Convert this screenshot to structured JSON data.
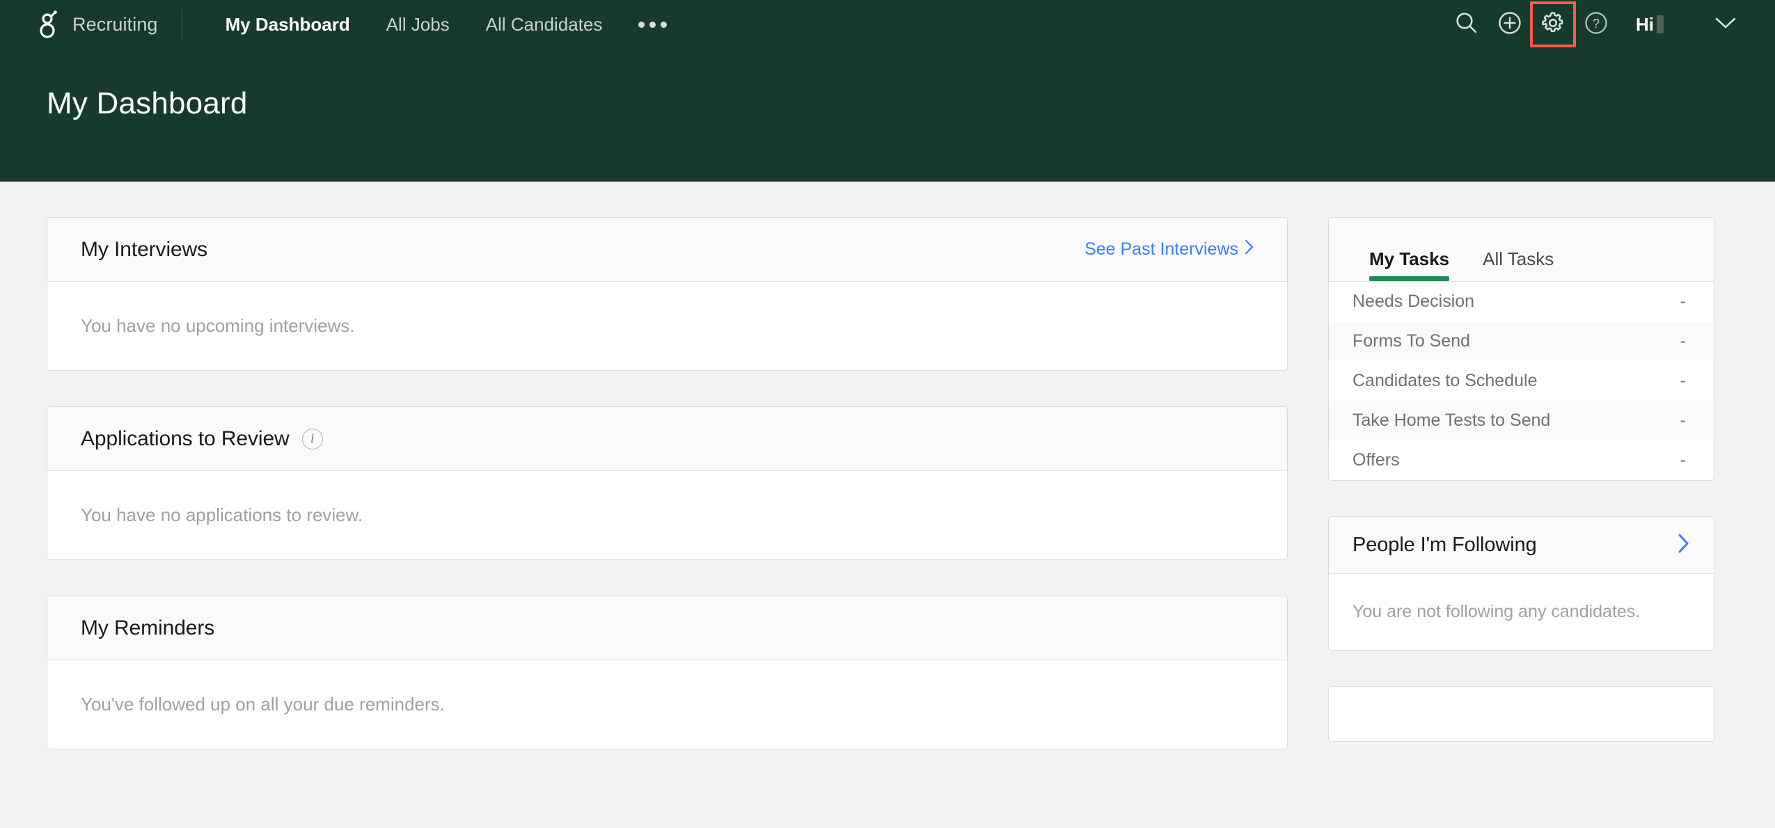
{
  "header": {
    "logo_icon": "greenhouse-g-logo",
    "brand": "Recruiting",
    "nav": [
      {
        "label": "My Dashboard",
        "active": true
      },
      {
        "label": "All Jobs",
        "active": false
      },
      {
        "label": "All Candidates",
        "active": false
      }
    ],
    "more_menu_icon": "ellipsis-icon",
    "actions": [
      {
        "name": "search-icon",
        "highlighted": false
      },
      {
        "name": "add-icon",
        "highlighted": false
      },
      {
        "name": "gear-icon",
        "highlighted": true
      },
      {
        "name": "help-icon",
        "highlighted": false
      }
    ],
    "greeting": "Hi",
    "account_chevron_icon": "chevron-down-icon",
    "page_title": "My Dashboard",
    "highlight_color": "#fb5a47",
    "background_color": "#183a2c"
  },
  "main": {
    "cards": [
      {
        "title": "My Interviews",
        "link_label": "See Past Interviews",
        "link_chevron": "›",
        "has_info_icon": false,
        "empty_text": "You have no upcoming interviews."
      },
      {
        "title": "Applications to Review",
        "link_label": "",
        "has_info_icon": true,
        "info_glyph": "i",
        "empty_text": "You have no applications to review."
      },
      {
        "title": "My Reminders",
        "link_label": "",
        "has_info_icon": false,
        "empty_text": "You've followed up on all your due reminders."
      }
    ],
    "link_color": "#3d7ff0"
  },
  "sidebar": {
    "tasks": {
      "tabs": [
        {
          "label": "My Tasks",
          "active": true
        },
        {
          "label": "All Tasks",
          "active": false
        }
      ],
      "active_underline_color": "#1f8a5a",
      "rows": [
        {
          "label": "Needs Decision",
          "count": "-"
        },
        {
          "label": "Forms To Send",
          "count": "-"
        },
        {
          "label": "Candidates to Schedule",
          "count": "-"
        },
        {
          "label": "Take Home Tests to Send",
          "count": "-"
        },
        {
          "label": "Offers",
          "count": "-"
        }
      ]
    },
    "following": {
      "title": "People I'm Following",
      "chevron_icon": "chevron-right-icon",
      "chevron_color": "#3d7ff0",
      "empty_text": "You are not following any candidates."
    }
  }
}
